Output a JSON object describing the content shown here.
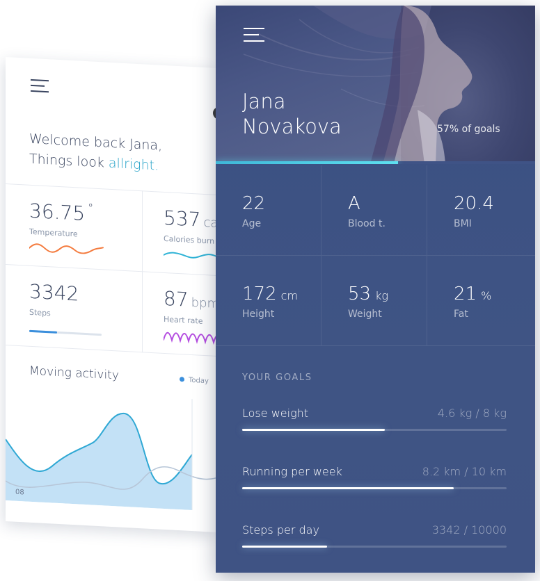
{
  "back_card": {
    "welcome_line1": "Welcome back Jana,",
    "welcome_line2_prefix": "Things look ",
    "welcome_line2_accent": "allright.",
    "tiles": [
      {
        "value": "36.75",
        "suffix": "°",
        "label": "Temperature"
      },
      {
        "value": "537",
        "suffix": "ca",
        "label": "Calories burn"
      },
      {
        "value": "3342",
        "suffix": "",
        "label": "Steps"
      },
      {
        "value": "87",
        "suffix": "bpm",
        "label": "Heart rate"
      }
    ],
    "steps_progress": 0.38,
    "moving_title": "Moving activity",
    "legend_today": "Today",
    "axis_first_label": "08"
  },
  "front_card": {
    "first_name": "Jana",
    "last_name": "Novakova",
    "goals_percent_text": "57% of goals",
    "goals_percent": 0.57,
    "stats": [
      {
        "value": "22",
        "unit": "",
        "label": "Age"
      },
      {
        "value": "A",
        "unit": "",
        "label": "Blood t."
      },
      {
        "value": "20.4",
        "unit": "",
        "label": "BMI"
      },
      {
        "value": "172",
        "unit": "cm",
        "label": "Height"
      },
      {
        "value": "53",
        "unit": "kg",
        "label": "Weight"
      },
      {
        "value": "21",
        "unit": "%",
        "label": "Fat"
      }
    ],
    "goals_title": "YOUR GOALS",
    "goals": [
      {
        "label": "Lose weight",
        "value": "4.6 kg / 8 kg",
        "progress": 0.54
      },
      {
        "label": "Running per week",
        "value": "8.2 km / 10 km",
        "progress": 0.8
      },
      {
        "label": "Steps per day",
        "value": "3342 / 10000",
        "progress": 0.32
      }
    ]
  },
  "colors": {
    "accent": "#27a3c8",
    "front_bg": "#3d5283",
    "temperature_wave": "#f47b3e",
    "calories_wave": "#2fb3d6",
    "heart_wave": "#b44ce0",
    "steps_bar": "#3b8fdc",
    "hero_bar": "#5ee0f0"
  },
  "icons": {
    "menu": "hamburger-menu-icon"
  }
}
